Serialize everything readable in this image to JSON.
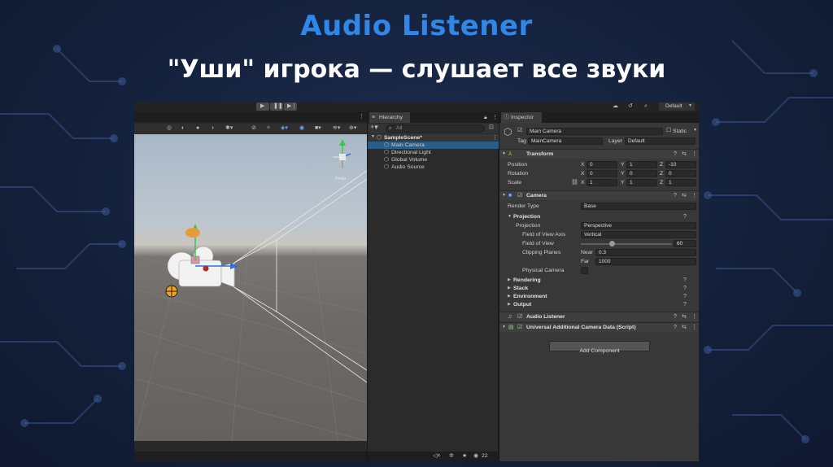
{
  "slide": {
    "title": "Audio Listener",
    "subtitle": "\"Уши\" игрока — слушает все звуки"
  },
  "toolbar": {
    "layout_label": "Default",
    "gizmo_label": "Persp",
    "stats_count": "22"
  },
  "hierarchy": {
    "tab": "Hierarchy",
    "search_placeholder": "All",
    "scene": "SampleScene*",
    "items": [
      "Main Camera",
      "Directional Light",
      "Global Volume",
      "Audio Source"
    ]
  },
  "inspector": {
    "tab": "Inspector",
    "object_name": "Main Camera",
    "static_label": "Static",
    "tag_label": "Tag",
    "tag_value": "MainCamera",
    "layer_label": "Layer",
    "layer_value": "Default",
    "transform": {
      "title": "Transform",
      "rows": [
        {
          "label": "Position",
          "x": "0",
          "y": "1",
          "z": "-10"
        },
        {
          "label": "Rotation",
          "x": "0",
          "y": "0",
          "z": "0"
        },
        {
          "label": "Scale",
          "x": "1",
          "y": "1",
          "z": "1"
        }
      ],
      "axis_x": "X",
      "axis_y": "Y",
      "axis_z": "Z"
    },
    "camera": {
      "title": "Camera",
      "render_type_label": "Render Type",
      "render_type_value": "Base",
      "projection_header": "Projection",
      "projection_label": "Projection",
      "projection_value": "Perspective",
      "fov_axis_label": "Field of View Axis",
      "fov_axis_value": "Vertical",
      "fov_label": "Field of View",
      "fov_value": "60",
      "fov_fraction": 0.33,
      "clipping_label": "Clipping Planes",
      "near_label": "Near",
      "near_value": "0.3",
      "far_label": "Far",
      "far_value": "1000",
      "physical_label": "Physical Camera",
      "sections": [
        "Rendering",
        "Stack",
        "Environment",
        "Output"
      ]
    },
    "audio_listener": "Audio Listener",
    "urp_data": "Universal Additional Camera Data (Script)",
    "add_component": "Add Component"
  }
}
